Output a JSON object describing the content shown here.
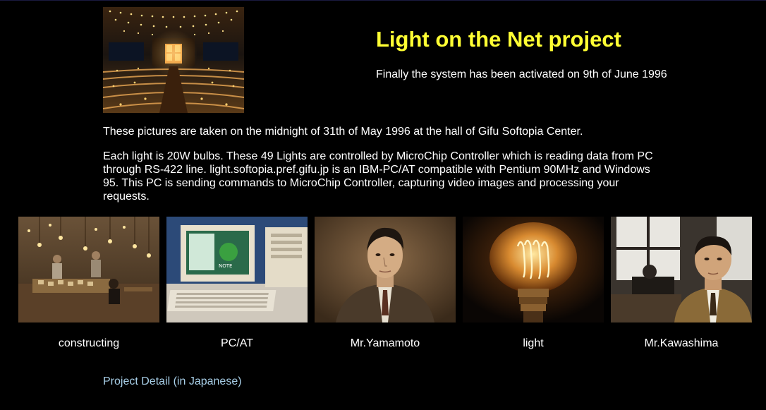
{
  "header": {
    "title": "Light on the Net project",
    "subtitle": "Finally the system has been activated on 9th of June 1996"
  },
  "body": {
    "paragraph1": "These pictures are taken on the midnight of 31th of May 1996 at the hall of Gifu Softopia Center.",
    "paragraph2": "Each light is 20W bulbs. These 49 Lights are controlled by MicroChip Controller which is reading data from PC through RS-422 line. light.softopia.pref.gifu.jp is an IBM-PC/AT compatible with Pentium 90MHz and Windows 95. This PC is sending commands to MicroChip Controller, capturing video images and processing your requests."
  },
  "gallery": {
    "items": [
      {
        "caption": "constructing"
      },
      {
        "caption": "PC/AT"
      },
      {
        "caption": "Mr.Yamamoto"
      },
      {
        "caption": "light"
      },
      {
        "caption": "Mr.Kawashima"
      }
    ]
  },
  "footer": {
    "link_label": "Project Detail (in Japanese)"
  },
  "colors": {
    "background": "#000000",
    "title": "#ffff33",
    "link": "#a8cfe8",
    "text": "#ffffff"
  }
}
